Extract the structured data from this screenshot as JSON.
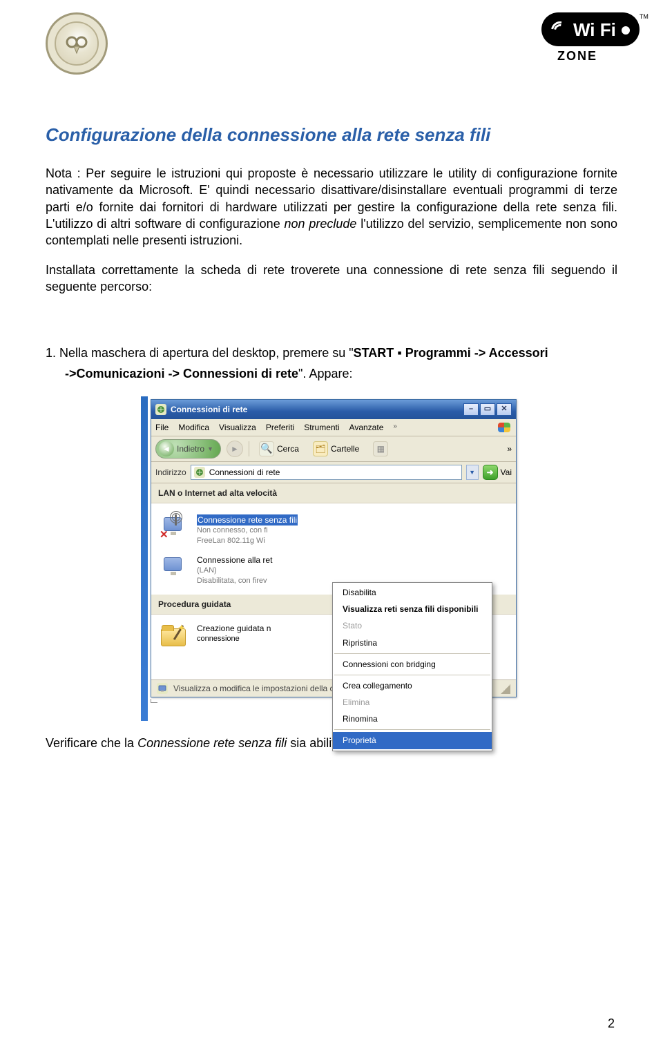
{
  "header": {
    "wifi_label": "Wi Fi",
    "wifi_zone": "ZONE",
    "wifi_tm": "TM"
  },
  "h1": "Configurazione della connessione alla rete senza fili",
  "p1_a": "Nota : Per seguire le istruzioni qui proposte è necessario utilizzare le utility di configurazione fornite nativamente da Microsoft. E' quindi necessario disattivare/disinstallare eventuali programmi di terze parti e/o fornite dai fornitori di hardware utilizzati per gestire la configurazione della rete senza fili. L'utilizzo di altri software di configurazione ",
  "p1_em": "non preclude",
  "p1_b": " l'utilizzo del servizio, semplicemente non sono contemplati nelle presenti istruzioni.",
  "p2": "Installata correttamente la scheda di rete troverete una connessione di rete senza fili seguendo il seguente percorso:",
  "step_num": "1.",
  "step_a": " Nella maschera di apertura del desktop, premere su \"",
  "step_start": "START",
  "step_b": "  ",
  "step_dot": "▪",
  "step_c": " ",
  "step_prog": "Programmi -> Accessori ",
  "step_comm": "->Comunicazioni -> Connessioni di rete",
  "step_d": "\". Appare:",
  "win": {
    "title": "Connessioni di rete",
    "menu": [
      "File",
      "Modifica",
      "Visualizza",
      "Preferiti",
      "Strumenti",
      "Avanzate"
    ],
    "menu_more": "»",
    "tb_back": "Indietro",
    "tb_search": "Cerca",
    "tb_folders": "Cartelle",
    "tb_more": "»",
    "addr_label": "Indirizzo",
    "addr_value": "Connessioni di rete",
    "go": "Vai",
    "section_lan": "LAN o Internet ad alta velocità",
    "wifi": {
      "t1": "Connessione rete senza fili",
      "t2": "Non connesso, con fi",
      "t3": "FreeLan 802.11g Wi"
    },
    "lan": {
      "t1": "Connessione alla ret",
      "t2": "(LAN)",
      "t3": "Disabilitata, con firev"
    },
    "section_wizard": "Procedura guidata",
    "wizard": {
      "t1": "Creazione guidata n",
      "t2": "connessione"
    },
    "ctx": {
      "disable": "Disabilita",
      "view": "Visualizza reti senza fili disponibili",
      "status": "Stato",
      "repair": "Ripristina",
      "bridge": "Connessioni con bridging",
      "shortcut": "Crea collegamento",
      "delete": "Elimina",
      "rename": "Rinomina",
      "props": "Proprietà"
    },
    "status": "Visualizza o modifica le impostazioni della connessione, come le impostaz"
  },
  "verify_a": "Verificare che la ",
  "verify_em": "Connessione rete senza fili",
  "verify_b": " sia abilitata, diversamente abilitarla",
  "page_number": "2"
}
